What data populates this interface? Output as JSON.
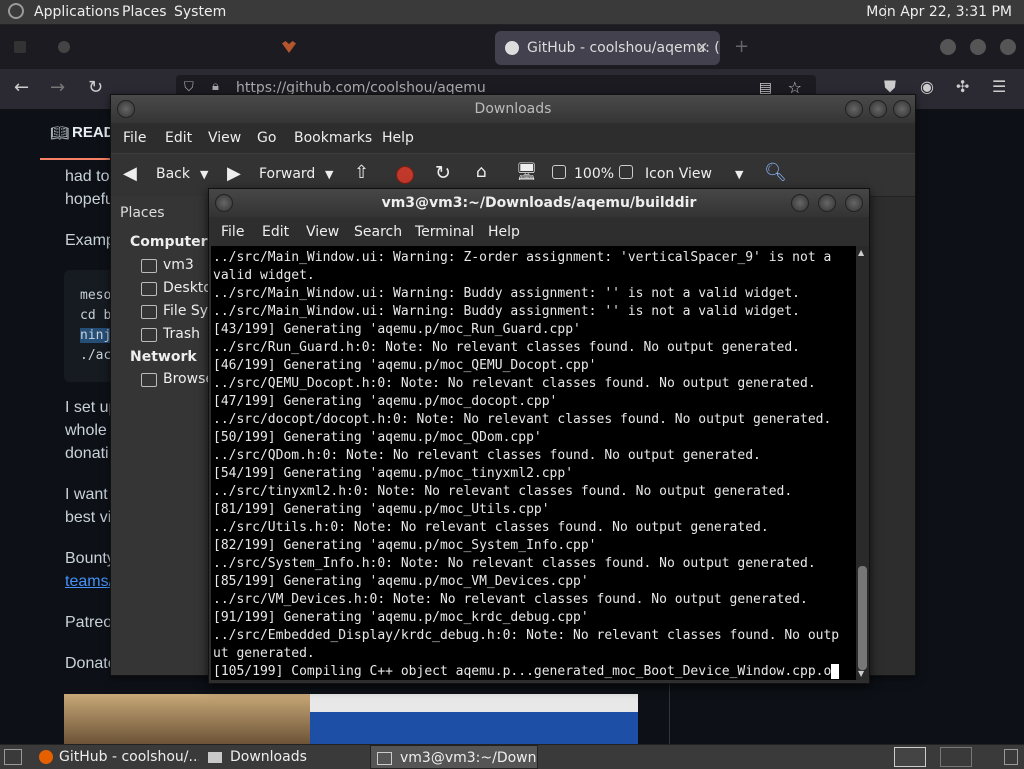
{
  "top_panel": {
    "menus": [
      "Applications",
      "Places",
      "System"
    ],
    "clock": "Mon Apr 22,  3:31 PM"
  },
  "firefox": {
    "active_tab": "GitHub - coolshou/aqemu: (",
    "url": "https://github.com/coolshou/aqemu"
  },
  "github_page": {
    "readme_tab": "READ",
    "para1": [
      "had to",
      "hopefu"
    ],
    "example_label": "Examp",
    "code_lines": [
      "meso",
      "cd b",
      "ninj",
      "./ac"
    ],
    "para2": [
      "I set up",
      "whole",
      "donati"
    ],
    "para3": [
      "I want",
      "best vi"
    ],
    "bounty": [
      "Bounty",
      "teams/"
    ],
    "patreon": "Patreo",
    "donate": "Donate"
  },
  "downloads_window": {
    "title": "Downloads",
    "menu": [
      "File",
      "Edit",
      "View",
      "Go",
      "Bookmarks",
      "Help"
    ],
    "toolbar": {
      "back": "Back",
      "forward": "Forward",
      "zoom": "100%",
      "view_mode": "Icon View"
    },
    "sidebar": {
      "header": "Places",
      "computer_heading": "Computer",
      "computer_items": [
        "vm3",
        "Desktop",
        "File Syst",
        "Trash"
      ],
      "network_heading": "Network",
      "network_items": [
        "Browse"
      ]
    }
  },
  "terminal_window": {
    "title": "vm3@vm3:~/Downloads/aqemu/builddir",
    "menu": [
      "File",
      "Edit",
      "View",
      "Search",
      "Terminal",
      "Help"
    ],
    "lines": [
      "../src/Main_Window.ui: Warning: Z-order assignment: 'verticalSpacer_9' is not a",
      "valid widget.",
      "../src/Main_Window.ui: Warning: Buddy assignment: '' is not a valid widget.",
      "../src/Main_Window.ui: Warning: Buddy assignment: '' is not a valid widget.",
      "[43/199] Generating 'aqemu.p/moc_Run_Guard.cpp'",
      "../src/Run_Guard.h:0: Note: No relevant classes found. No output generated.",
      "[46/199] Generating 'aqemu.p/moc_QEMU_Docopt.cpp'",
      "../src/QEMU_Docopt.h:0: Note: No relevant classes found. No output generated.",
      "[47/199] Generating 'aqemu.p/moc_docopt.cpp'",
      "../src/docopt/docopt.h:0: Note: No relevant classes found. No output generated.",
      "[50/199] Generating 'aqemu.p/moc_QDom.cpp'",
      "../src/QDom.h:0: Note: No relevant classes found. No output generated.",
      "[54/199] Generating 'aqemu.p/moc_tinyxml2.cpp'",
      "../src/tinyxml2.h:0: Note: No relevant classes found. No output generated.",
      "[81/199] Generating 'aqemu.p/moc_Utils.cpp'",
      "../src/Utils.h:0: Note: No relevant classes found. No output generated.",
      "[82/199] Generating 'aqemu.p/moc_System_Info.cpp'",
      "../src/System_Info.h:0: Note: No relevant classes found. No output generated.",
      "[85/199] Generating 'aqemu.p/moc_VM_Devices.cpp'",
      "../src/VM_Devices.h:0: Note: No relevant classes found. No output generated.",
      "[91/199] Generating 'aqemu.p/moc_krdc_debug.cpp'",
      "../src/Embedded_Display/krdc_debug.h:0: Note: No relevant classes found. No outp",
      "ut generated.",
      "[105/199] Compiling C++ object aqemu.p...generated_moc_Boot_Device_Window.cpp.o"
    ]
  },
  "taskbar": {
    "items": [
      "GitHub - coolshou/...",
      "Downloads",
      "vm3@vm3:~/Downl..."
    ]
  },
  "colors": {
    "panel": "#3a3a3a",
    "github_bg": "#0d1117",
    "terminal_bg": "#000000",
    "readme_accent": "#f78166"
  }
}
